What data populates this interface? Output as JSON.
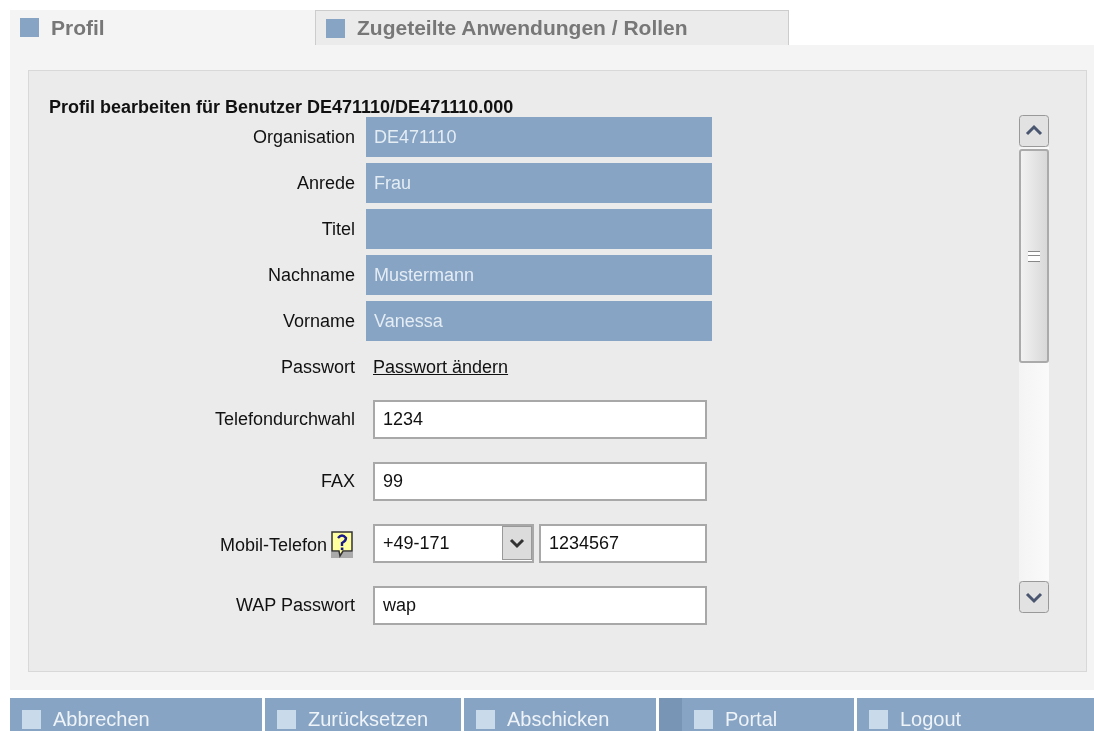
{
  "tabs": [
    {
      "label": "Profil",
      "selected": true
    },
    {
      "label": "Zugeteilte Anwendungen / Rollen",
      "selected": false
    }
  ],
  "form": {
    "heading": "Profil bearbeiten für Benutzer DE471110/DE471110.000",
    "rows": [
      {
        "kind": "readonly",
        "label": "Organisation",
        "value": "DE471110"
      },
      {
        "kind": "readonly",
        "label": "Anrede",
        "value": "Frau"
      },
      {
        "kind": "readonly",
        "label": "Titel"
      },
      {
        "kind": "readonly",
        "label": "Nachname",
        "value": "Mustermann"
      },
      {
        "kind": "readonly",
        "label": "Vorname",
        "value": "Vanessa"
      },
      {
        "kind": "link",
        "label": "Passwort",
        "value": "Passwort ändern"
      },
      {
        "kind": "input",
        "label": "Telefondurchwahl",
        "value": "1234"
      },
      {
        "kind": "input",
        "label": "FAX",
        "value": "99"
      },
      {
        "kind": "phone",
        "label": "Mobil-Telefon",
        "help": true,
        "prefix": "+49-171",
        "value": "1234567"
      },
      {
        "kind": "input",
        "label": "WAP Passwort",
        "value": "wap"
      }
    ]
  },
  "buttons": [
    {
      "label": "Abbrechen"
    },
    {
      "label": "Zurücksetzen"
    },
    {
      "label": "Abschicken"
    },
    {
      "label": "Portal"
    },
    {
      "label": "Logout"
    }
  ]
}
